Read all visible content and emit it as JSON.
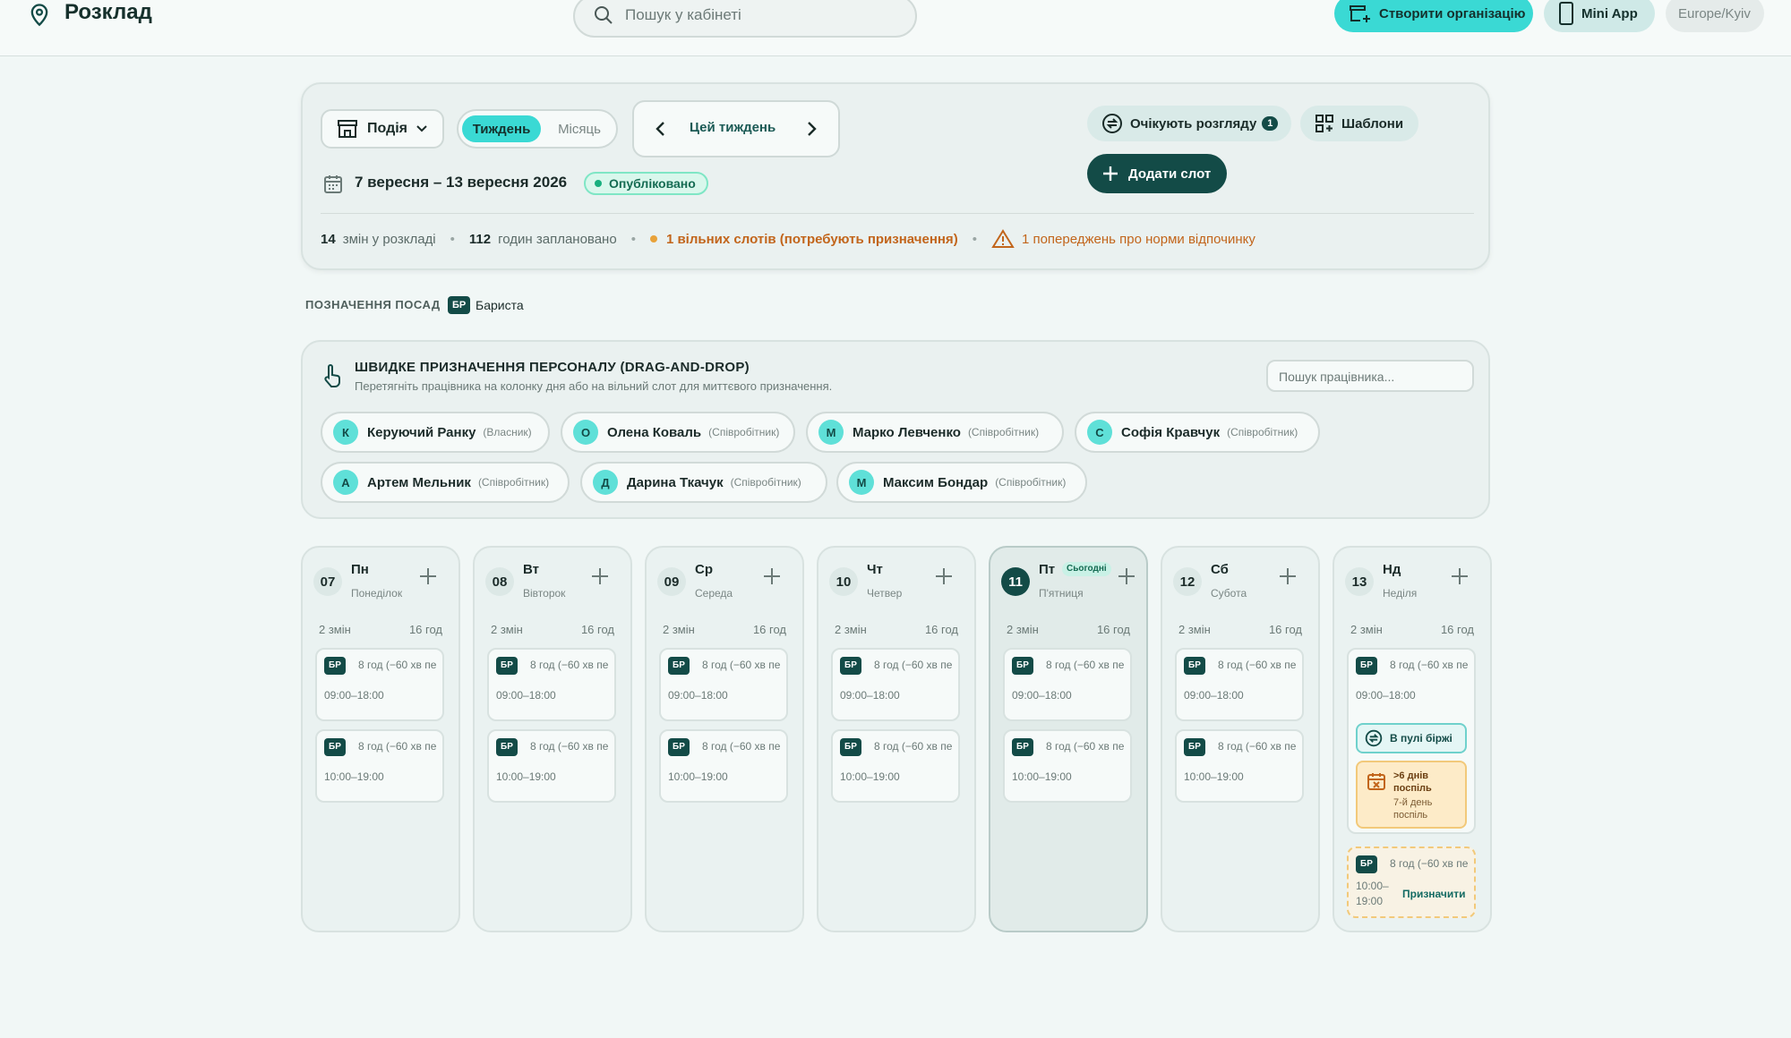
{
  "header": {
    "title": "Розклад",
    "search_placeholder": "Пошук у кабінеті",
    "create_org_label": "Створити організацію",
    "mini_app_label": "Mini App",
    "timezone": "Europe/Kyiv"
  },
  "toolbar": {
    "event_label": "Подія",
    "view_week": "Тиждень",
    "view_month": "Місяць",
    "current_week": "Цей тиждень",
    "date_range": "7 вересня – 13 вересня 2026",
    "status": "Опубліковано",
    "pending_label": "Очікують розгляду",
    "pending_count": "1",
    "templates_label": "Шаблони",
    "add_slot_label": "Додати слот"
  },
  "stats": {
    "shifts_count": "14",
    "shifts_label": "змін у розкладі",
    "hours_count": "112",
    "hours_label": "годин заплановано",
    "free_slots": "1 вільних слотів (потребують призначення)",
    "rest_warnings": "1 попереджень про норми відпочинку"
  },
  "positions": {
    "label": "ПОЗНАЧЕННЯ ПОСАД",
    "items": [
      {
        "code": "БР",
        "name": "Бариста"
      }
    ]
  },
  "quick_assign": {
    "title": "ШВИДКЕ ПРИЗНАЧЕННЯ ПЕРСОНАЛУ (DRAG-AND-DROP)",
    "subtitle": "Перетягніть працівника на колонку дня або на вільний слот для миттєвого призначення.",
    "search_placeholder": "Пошук працівника...",
    "workers": [
      {
        "initial": "К",
        "name": "Керуючий Ранку",
        "role": "(Власник)"
      },
      {
        "initial": "О",
        "name": "Олена Коваль",
        "role": "(Співробітник)"
      },
      {
        "initial": "М",
        "name": "Марко Левченко",
        "role": "(Співробітник)"
      },
      {
        "initial": "С",
        "name": "Софія Кравчук",
        "role": "(Співробітник)"
      },
      {
        "initial": "А",
        "name": "Артем Мельник",
        "role": "(Співробітник)"
      },
      {
        "initial": "Д",
        "name": "Дарина Ткачук",
        "role": "(Співробітник)"
      },
      {
        "initial": "М",
        "name": "Максим Бондар",
        "role": "(Співробітник)"
      }
    ]
  },
  "days": [
    {
      "num": "07",
      "short": "Пн",
      "long": "Понеділок",
      "shifts": "2 змін",
      "hours": "16 год"
    },
    {
      "num": "08",
      "short": "Вт",
      "long": "Вівторок",
      "shifts": "2 змін",
      "hours": "16 год"
    },
    {
      "num": "09",
      "short": "Ср",
      "long": "Середа",
      "shifts": "2 змін",
      "hours": "16 год"
    },
    {
      "num": "10",
      "short": "Чт",
      "long": "Четвер",
      "shifts": "2 змін",
      "hours": "16 год"
    },
    {
      "num": "11",
      "short": "Пт",
      "long": "П'ятниця",
      "shifts": "2 змін",
      "hours": "16 год",
      "today_label": "Сьогодні"
    },
    {
      "num": "12",
      "short": "Сб",
      "long": "Субота",
      "shifts": "2 змін",
      "hours": "16 год"
    },
    {
      "num": "13",
      "short": "Нд",
      "long": "Неділя",
      "shifts": "2 змін",
      "hours": "16 год"
    }
  ],
  "shift_template": {
    "badge": "БР",
    "duration": "8 год (−60 хв пе",
    "time_morning": "09:00–18:00",
    "time_day": "10:00–19:00"
  },
  "sunday_extra": {
    "exchange_label": "В пулі біржі",
    "streak_title": ">6 днів поспіль",
    "streak_sub": "7-й день поспіль",
    "open_time": "10:00–19:00",
    "assign_label": "Призначити"
  },
  "colors": {
    "accent": "#3ad9d4",
    "dark": "#134b47",
    "warning": "#c2651b",
    "background": "#f1f7f6"
  }
}
